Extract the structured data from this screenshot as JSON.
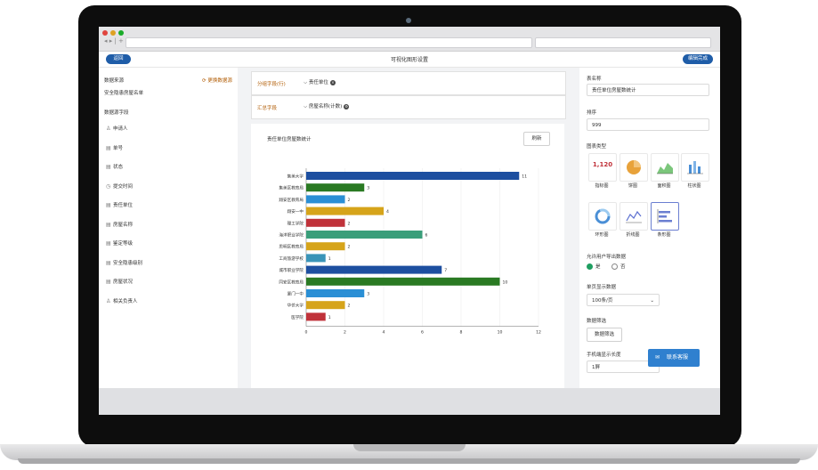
{
  "app": {
    "back_label": "返回",
    "title": "可视化图形设置",
    "done_label": "编辑完成"
  },
  "left": {
    "source_label": "数据来源",
    "switch_label": "更换数据源",
    "source_name": "安全隐患房屋名单",
    "fields_label": "数据源字段",
    "fields": [
      {
        "label": "申请人",
        "icon": "user-icon"
      },
      {
        "label": "单号",
        "icon": "doc-icon"
      },
      {
        "label": "状态",
        "icon": "doc-icon"
      },
      {
        "label": "提交时间",
        "icon": "clock-icon"
      },
      {
        "label": "责任单位",
        "icon": "doc-icon"
      },
      {
        "label": "房屋名称",
        "icon": "doc-icon"
      },
      {
        "label": "鉴定等级",
        "icon": "doc-icon"
      },
      {
        "label": "安全隐患级别",
        "icon": "doc-icon"
      },
      {
        "label": "房屋状况",
        "icon": "doc-icon"
      },
      {
        "label": "相关负责人",
        "icon": "user-icon"
      }
    ]
  },
  "config": {
    "group_label": "分组字段(行)",
    "group_chip": "责任单位",
    "summary_label": "汇总字段",
    "summary_chip": "房屋名称(计数)"
  },
  "chart_panel": {
    "title": "责任单位房屋数统计",
    "refresh_label": "刷新"
  },
  "chart_data": {
    "type": "bar",
    "orientation": "horizontal",
    "categories": [
      "集美大学",
      "集美区教育局",
      "翔安区教育局",
      "翔安一中",
      "理工学院",
      "海洋职业学院",
      "思明区教育局",
      "工商旅游学校",
      "城市职业学院",
      "同安区教育局",
      "厦门一中",
      "华侨大学",
      "医学院"
    ],
    "values": [
      11,
      3,
      2,
      4,
      2,
      6,
      2,
      1,
      7,
      10,
      3,
      2,
      1
    ],
    "colors": [
      "#1d4fa0",
      "#2a7a23",
      "#2b8fd5",
      "#d6a41a",
      "#c0323a",
      "#3a9e7a",
      "#d6a41a",
      "#3a94b8",
      "#1d4fa0",
      "#2a7a23",
      "#2b8fd5",
      "#d6a41a",
      "#c0323a"
    ],
    "x_ticks": [
      "0",
      "2",
      "4",
      "6",
      "8",
      "10",
      "12"
    ],
    "xlim": [
      0,
      12
    ]
  },
  "right": {
    "table_name_label": "表名称",
    "table_name_value": "责任单位房屋数统计",
    "order_label": "排序",
    "order_value": "999",
    "chart_type_label": "图表类型",
    "chart_types": [
      {
        "name": "指标图",
        "icon": "indicator-icon",
        "sample": "1,120"
      },
      {
        "name": "饼图",
        "icon": "pie-chart-icon"
      },
      {
        "name": "面积图",
        "icon": "area-chart-icon"
      },
      {
        "name": "柱状图",
        "icon": "column-chart-icon"
      },
      {
        "name": "环形图",
        "icon": "ring-chart-icon"
      },
      {
        "name": "折线图",
        "icon": "line-chart-icon"
      },
      {
        "name": "条形图",
        "icon": "bar-chart-icon",
        "selected": true
      }
    ],
    "export_label": "允许用户导出数据",
    "export_yes": "是",
    "export_no": "否",
    "page_size_label": "单页显示数据",
    "page_size_value": "100条/页",
    "filter_label": "数据筛选",
    "filter_button": "数据筛选",
    "mobile_len_label": "手机端显示长度",
    "mobile_len_value": "1屏"
  },
  "support_label": "联系客服"
}
